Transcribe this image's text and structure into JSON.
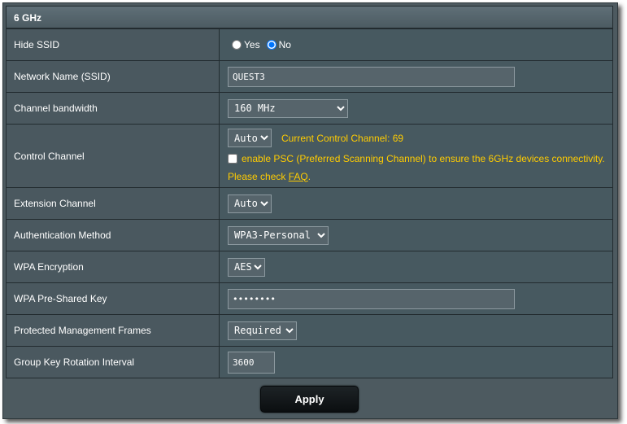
{
  "section": {
    "title": "6 GHz"
  },
  "hide_ssid": {
    "label": "Hide SSID",
    "options": [
      "Yes",
      "No"
    ],
    "selected": "No"
  },
  "network_name": {
    "label": "Network Name (SSID)",
    "value": "QUEST3"
  },
  "channel_bandwidth": {
    "label": "Channel bandwidth",
    "selected": "160 MHz"
  },
  "control_channel": {
    "label": "Control Channel",
    "selected": "Auto",
    "current_text": "Current Control Channel: 69",
    "psc_text": "enable PSC (Preferred Scanning Channel) to ensure the 6GHz devices connectivity.",
    "psc_checked": false,
    "check_prefix": "Please check ",
    "faq_link": "FAQ",
    "check_suffix": "."
  },
  "extension_channel": {
    "label": "Extension Channel",
    "selected": "Auto"
  },
  "auth_method": {
    "label": "Authentication Method",
    "selected": "WPA3-Personal"
  },
  "wpa_encryption": {
    "label": "WPA Encryption",
    "selected": "AES"
  },
  "psk": {
    "label": "WPA Pre-Shared Key",
    "value": "••••••••"
  },
  "pmf": {
    "label": "Protected Management Frames",
    "selected": "Required"
  },
  "group_key": {
    "label": "Group Key Rotation Interval",
    "value": "3600"
  },
  "apply": {
    "label": "Apply"
  },
  "colors": {
    "panel": "#4d5a60",
    "accent_text": "#ffcc00",
    "button": "#13181b"
  }
}
